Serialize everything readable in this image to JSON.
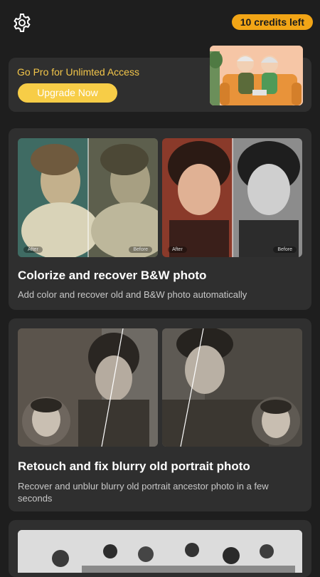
{
  "header": {
    "settings_icon": "gear-icon",
    "credits_label": "10 credits left",
    "credits_color": "#f2a516"
  },
  "promo": {
    "title": "Go Pro for Unlimted Access",
    "button_label": "Upgrade Now",
    "accent": "#f7cd47"
  },
  "features": [
    {
      "title": "Colorize and recover B&W photo",
      "description": "Add color and recover old and B&W photo automatically",
      "after_label": "After",
      "before_label": "Before"
    },
    {
      "title": "Retouch and fix blurry old portrait photo",
      "description": "Recover and unblur blurry old portrait ancestor photo in a few seconds"
    }
  ]
}
